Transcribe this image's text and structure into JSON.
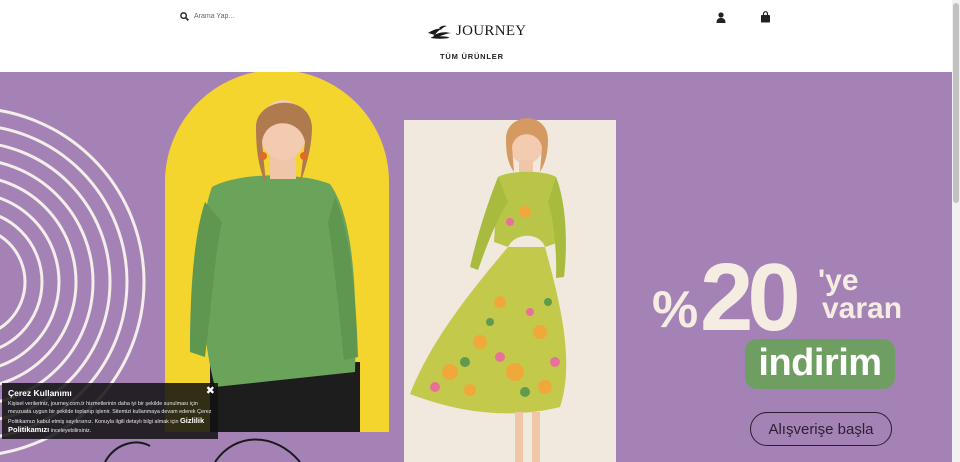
{
  "header": {
    "search": {
      "placeholder": "Arama Yap..."
    },
    "logo": {
      "text": "JOURNEY"
    },
    "nav": {
      "all_products": "TÜM ÜRÜNLER"
    }
  },
  "banner": {
    "headline": {
      "percent": "%",
      "value": "20",
      "suffix1": "'ye",
      "suffix2": "varan"
    },
    "badge": "indirim",
    "cta": "Alışverişe başla"
  },
  "cookie": {
    "title": "Çerez Kullanımı",
    "body": "Kişisel verileriniz, journey.com.tr hizmetlerinin daha iyi bir şekilde sunulması için mevzuata uygun bir şekilde toplanıp işlenir. Sitemizi kullanmaya devam ederek Çerez Politikamızı kabul etmiş sayılırsınız. Konuyla ilgili detaylı bilgi almak için",
    "link": "Gizlilik Politikamızı",
    "tail": "inceleyebilirsiniz.",
    "close": "✖"
  },
  "colors": {
    "banner_bg": "#a582b6",
    "yellow_arch": "#f4d52e",
    "cream_arch": "#f1e9dd",
    "badge_green": "#6f9e62",
    "headline_cream": "#f5ede2"
  }
}
